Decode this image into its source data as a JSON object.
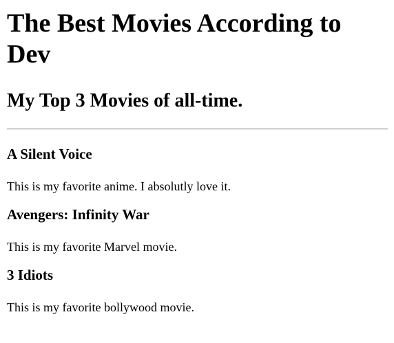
{
  "page": {
    "title": "The Best Movies According to Dev",
    "subtitle": "My Top 3 Movies of all-time."
  },
  "movies": [
    {
      "name": "A Silent Voice",
      "description": "This is my favorite anime. I absolutly love it."
    },
    {
      "name": "Avengers: Infinity War",
      "description": "This is my favorite Marvel movie."
    },
    {
      "name": "3 Idiots",
      "description": "This is my favorite bollywood movie."
    }
  ]
}
